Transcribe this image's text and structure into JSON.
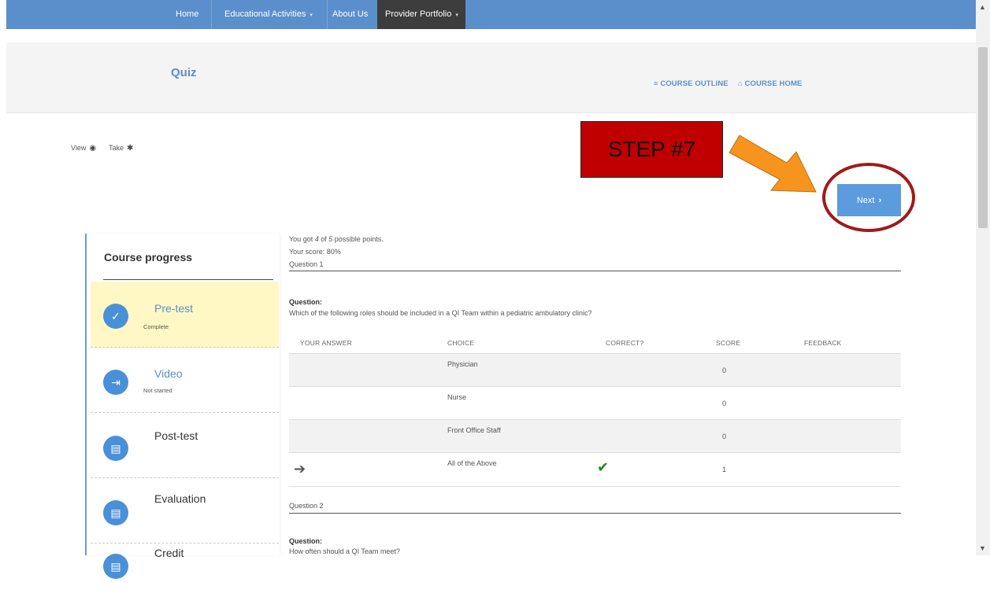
{
  "nav": {
    "items": [
      {
        "label": "Home"
      },
      {
        "label": "Educational Activities",
        "caret": "▾"
      },
      {
        "label": "About Us"
      },
      {
        "label": "Provider Portfolio",
        "caret": "▾"
      }
    ]
  },
  "header": {
    "title": "Quiz",
    "course_outline": "COURSE OUTLINE",
    "course_home": "COURSE HOME"
  },
  "mode": {
    "view": "View",
    "take": "Take"
  },
  "next_button": {
    "label": "Next",
    "chevron": "›"
  },
  "annotation": {
    "label": "STEP #7",
    "box_color": "#c00000",
    "arrow_color": "#f7941d",
    "circle_color": "#a01a1a"
  },
  "sidebar": {
    "title": "Course progress",
    "items": [
      {
        "name": "Pre-test",
        "status": "Complete",
        "icon": "check-icon"
      },
      {
        "name": "Video",
        "status": "Not started",
        "icon": "enter-icon"
      },
      {
        "name": "Post-test",
        "status": "",
        "icon": "book-icon"
      },
      {
        "name": "Evaluation",
        "status": "",
        "icon": "book-icon"
      },
      {
        "name": "Credit",
        "status": "",
        "icon": "book-icon"
      }
    ]
  },
  "results": {
    "points_prefix": "You got ",
    "points_got": "4",
    "points_mid": " of ",
    "points_total": "5",
    "points_suffix": " possible points.",
    "score_line": "Your score: 80%"
  },
  "question1": {
    "header": "Question 1",
    "label": "Question:",
    "text": "Which of the following roles should be included in a QI Team within a pediatric ambulatory clinic?",
    "columns": [
      "YOUR ANSWER",
      "CHOICE",
      "CORRECT?",
      "SCORE",
      "FEEDBACK"
    ],
    "rows": [
      {
        "your_answer": "",
        "choice": "Physician",
        "correct": "",
        "score": "0"
      },
      {
        "your_answer": "",
        "choice": "Nurse",
        "correct": "",
        "score": "0"
      },
      {
        "your_answer": "",
        "choice": "Front Office Staff",
        "correct": "",
        "score": "0"
      },
      {
        "your_answer": "➔",
        "choice": "All of the Above",
        "correct": "✔",
        "score": "1"
      }
    ]
  },
  "question2": {
    "header": "Question 2",
    "label": "Question:",
    "text": "How often should a QI Team meet?"
  },
  "colors": {
    "nav_bg": "#5b8fcb",
    "accent": "#5b8fcb",
    "button": "#5b9bde",
    "complete_bg": "#fff8c4",
    "check_green": "#1e8a1e"
  }
}
